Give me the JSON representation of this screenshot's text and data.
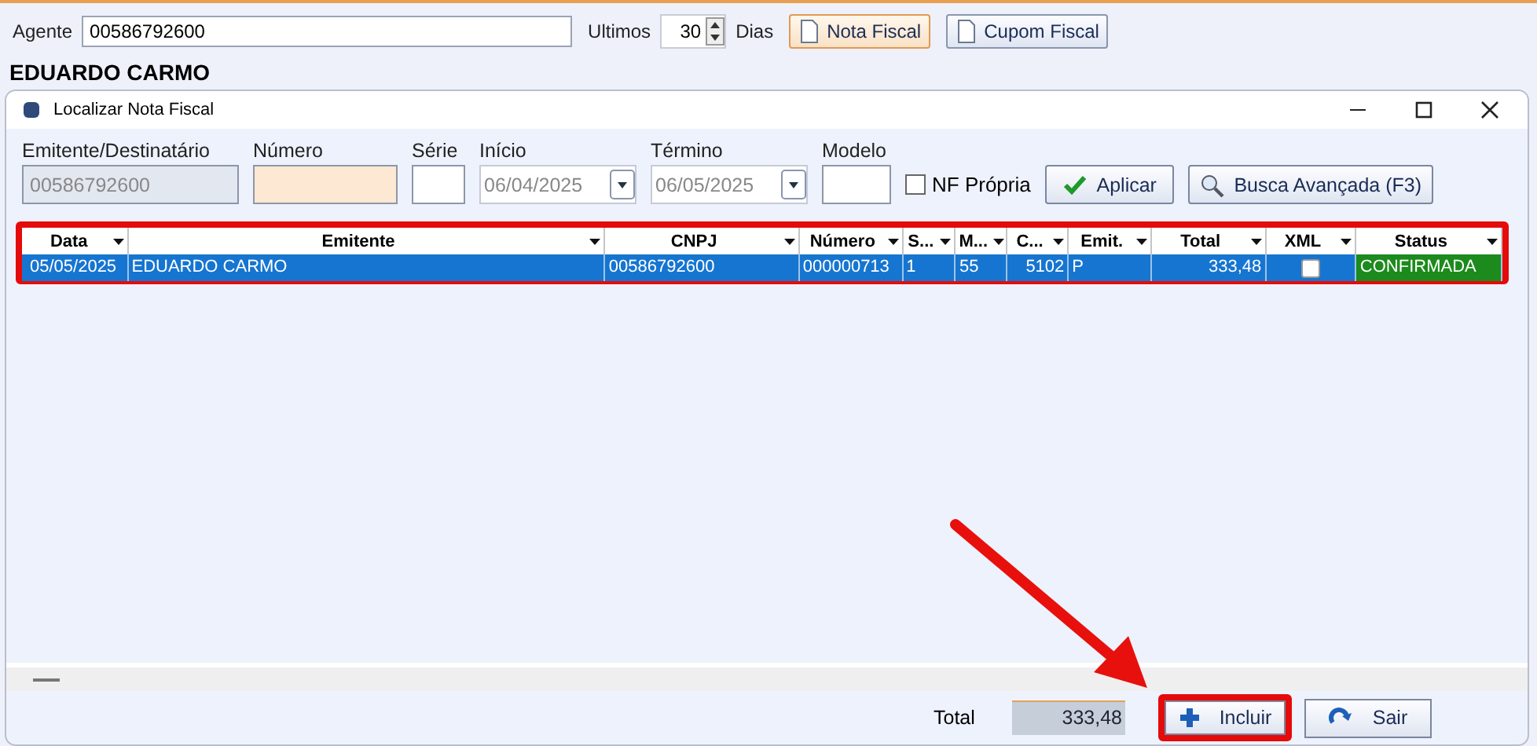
{
  "top_bar": {
    "agent_label": "Agente",
    "agent_value": "00586792600",
    "last_label": "Ultimos",
    "days_value": "30",
    "days_label": "Dias",
    "buttons": [
      {
        "label": "Nota Fiscal",
        "selected": true
      },
      {
        "label": "Cupom Fiscal",
        "selected": false
      }
    ]
  },
  "customer_name": "EDUARDO CARMO",
  "dialog": {
    "title": "Localizar Nota Fiscal",
    "filters": {
      "emitter_label": "Emitente/Destinatário",
      "emitter_value": "00586792600",
      "number_label": "Número",
      "series_label": "Série",
      "start_label": "Início",
      "start_value": "06/04/2025",
      "end_label": "Término",
      "end_value": "06/05/2025",
      "model_label": "Modelo",
      "own_nf_label": "NF Própria",
      "own_nf_checked": false,
      "apply_button": "Aplicar",
      "advanced_button": "Busca Avançada (F3)"
    },
    "table": {
      "columns": [
        "Data",
        "Emitente",
        "CNPJ",
        "Número",
        "S...",
        "M...",
        "C...",
        "Emit.",
        "Total",
        "XML",
        "Status"
      ],
      "rows": [
        {
          "selected": true,
          "cells": [
            "05/05/2025",
            "EDUARDO CARMO",
            "00586792600",
            "000000713",
            "1",
            "55",
            "5102",
            "P",
            "333,48"
          ],
          "xml_checked": false,
          "status": "CONFIRMADA",
          "color": "#1c8a1c"
        }
      ]
    },
    "footer": {
      "total_label": "Total",
      "total_value": "333,48",
      "include_button": "Incluir",
      "exit_button": "Sair"
    }
  }
}
